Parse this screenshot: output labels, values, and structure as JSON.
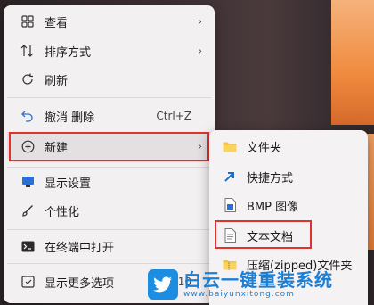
{
  "menu": {
    "items": [
      {
        "icon": "grid-icon",
        "label": "查看",
        "chevron": true
      },
      {
        "icon": "sort-icon",
        "label": "排序方式",
        "chevron": true
      },
      {
        "icon": "refresh-icon",
        "label": "刷新"
      },
      {
        "icon": "undo-icon",
        "label": "撤消 删除",
        "shortcut": "Ctrl+Z"
      },
      {
        "icon": "new-plus-icon",
        "label": "新建",
        "chevron": true
      },
      {
        "icon": "display-icon",
        "label": "显示设置"
      },
      {
        "icon": "brush-icon",
        "label": "个性化"
      },
      {
        "icon": "terminal-icon",
        "label": "在终端中打开"
      },
      {
        "icon": "more-options-icon",
        "label": "显示更多选项",
        "shortcut": "F10"
      }
    ]
  },
  "submenu": {
    "items": [
      {
        "icon": "folder-icon",
        "label": "文件夹"
      },
      {
        "icon": "shortcut-arrow-icon",
        "label": "快捷方式"
      },
      {
        "icon": "bmp-image-icon",
        "label": "BMP 图像"
      },
      {
        "icon": "text-doc-icon",
        "label": "文本文档"
      },
      {
        "icon": "zip-folder-icon",
        "label": "压缩(zipped)文件夹"
      }
    ]
  },
  "watermark": {
    "title": "白云一键重装系统",
    "url": "www.baiyunxitong.com"
  },
  "colors": {
    "highlight": "#e0322f",
    "accent": "#1c7fd6"
  }
}
